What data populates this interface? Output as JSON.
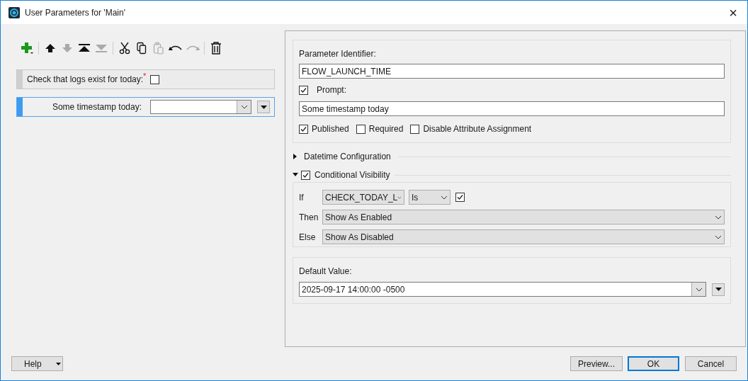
{
  "window": {
    "title": "User Parameters for 'Main'",
    "close": "×"
  },
  "toolbar": [
    {
      "kind": "add",
      "disabled": false
    },
    {
      "kind": "sep"
    },
    {
      "kind": "up",
      "disabled": false
    },
    {
      "kind": "down",
      "disabled": true
    },
    {
      "kind": "top",
      "disabled": false
    },
    {
      "kind": "bottom",
      "disabled": true
    },
    {
      "kind": "sep"
    },
    {
      "kind": "cut",
      "disabled": false
    },
    {
      "kind": "copy",
      "disabled": false
    },
    {
      "kind": "paste",
      "disabled": true
    },
    {
      "kind": "undo",
      "disabled": false
    },
    {
      "kind": "redo",
      "disabled": true
    },
    {
      "kind": "sep"
    },
    {
      "kind": "delete",
      "disabled": false
    }
  ],
  "parameters": [
    {
      "kind": "checkbox",
      "label": "Check that logs exist for today:",
      "required_mark": "*",
      "checked": false,
      "selected": false
    },
    {
      "kind": "datetime",
      "label": "Some timestamp today:",
      "selected": true
    }
  ],
  "details": {
    "identifier_label": "Parameter Identifier:",
    "identifier": "FLOW_LAUNCH_TIME",
    "prompt_label": "Prompt:",
    "prompt_checked": true,
    "prompt": "Some timestamp today",
    "flags": [
      {
        "label": "Published",
        "checked": true
      },
      {
        "label": "Required",
        "checked": false
      },
      {
        "label": "Disable Attribute Assignment",
        "checked": false
      }
    ],
    "datetime_section": {
      "label": "Datetime Configuration",
      "expanded": false
    },
    "visibility_section": {
      "label": "Conditional Visibility",
      "expanded": true,
      "checked": true
    },
    "condition": {
      "if_label": "If",
      "field": "CHECK_TODAY_L",
      "operator": "Is",
      "value_checked": true,
      "then_label": "Then",
      "then": "Show As Enabled",
      "else_label": "Else",
      "else": "Show As Disabled"
    },
    "default_label": "Default Value:",
    "default_value": "2025-09-17 14:00:00 -0500"
  },
  "buttons": {
    "help": "Help",
    "preview": "Preview...",
    "ok": "OK",
    "cancel": "Cancel"
  }
}
